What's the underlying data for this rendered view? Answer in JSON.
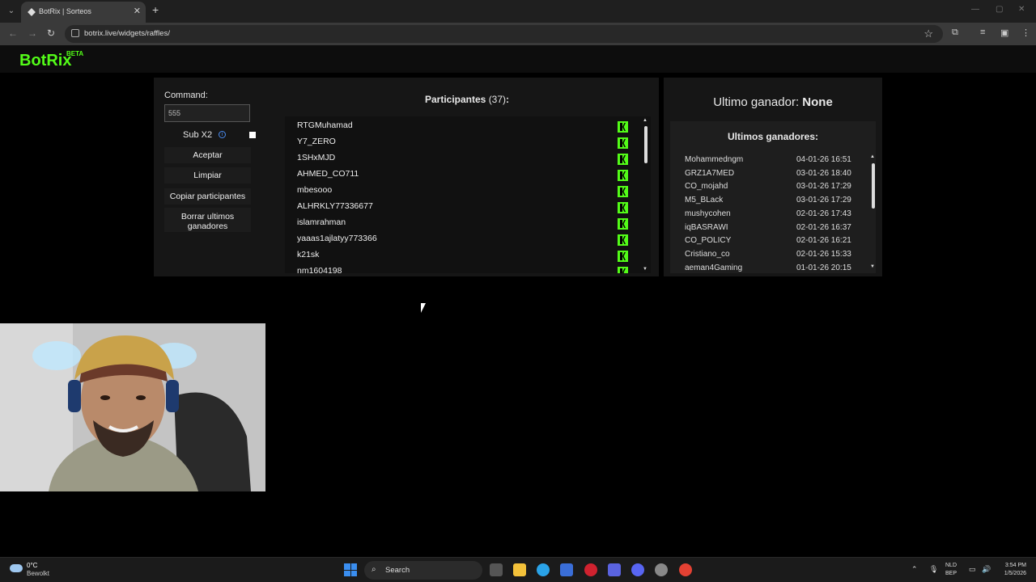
{
  "browser": {
    "tab_title": "BotRix | Sorteos",
    "url": "botrix.live/widgets/raffles/"
  },
  "site": {
    "logo": "BotRix",
    "badge": "BETA"
  },
  "controls": {
    "command_label": "Command:",
    "command_value": "555",
    "sub_label": "Sub X2",
    "info_icon": "info-icon",
    "buttons": {
      "accept": "Aceptar",
      "clear": "Limpiar",
      "copy": "Copiar participantes",
      "delete_line1": "Borrar ultimos",
      "delete_line2": "ganadores"
    }
  },
  "participants": {
    "title": "Participantes",
    "count": "(37)",
    "colon": ":",
    "platform_icon": "kick-icon",
    "items": [
      "RTGMuhamad",
      "Y7_ZERO",
      "1SHxMJD",
      "AHMED_CO711",
      "mbesooo",
      "ALHRKLY77336677",
      "islamrahman",
      "yaaas1ajlatyy773366",
      "k21sk",
      "nm1604198"
    ]
  },
  "winner": {
    "label": "Ultimo ganador:",
    "name": "None"
  },
  "recent_winners": {
    "title": "Ultimos ganadores:",
    "items": [
      {
        "name": "Mohammedngm",
        "date": "04-01-26 16:51"
      },
      {
        "name": "GRZ1A7MED",
        "date": "03-01-26 18:40"
      },
      {
        "name": "CO_mojahd",
        "date": "03-01-26 17:29"
      },
      {
        "name": "M5_BLack",
        "date": "03-01-26 17:29"
      },
      {
        "name": "mushycohen",
        "date": "02-01-26 17:43"
      },
      {
        "name": "iqBASRAWI",
        "date": "02-01-26 16:37"
      },
      {
        "name": "CO_POLICY",
        "date": "02-01-26 16:21"
      },
      {
        "name": "Cristiano_co",
        "date": "02-01-26 15:33"
      },
      {
        "name": "aeman4Gaming",
        "date": "01-01-26 20:15"
      }
    ]
  },
  "taskbar": {
    "temperature": "0°C",
    "weather": "Bewolkt",
    "search": "Search",
    "lang_line1": "NLD",
    "lang_line2": "BEP",
    "time": "3:54 PM",
    "date": "1/5/2026"
  },
  "colors": {
    "accent": "#53fc18",
    "panel": "#161616"
  }
}
